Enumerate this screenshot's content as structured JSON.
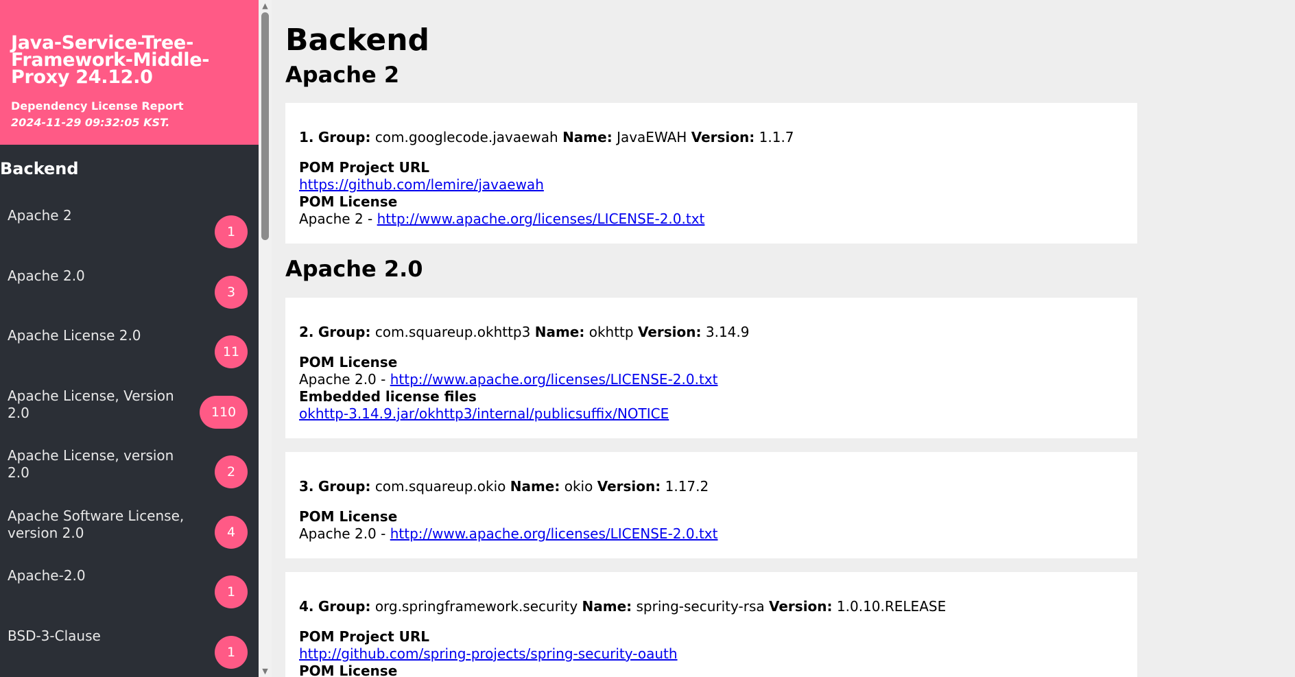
{
  "sidebar": {
    "project_title": "Java-Service-Tree-Framework-Middle-Proxy 24.12.0",
    "subtitle": "Dependency License Report",
    "timestamp": "2024-11-29 09:32:05 KST.",
    "section": "Backend",
    "items": [
      {
        "label": "Apache 2",
        "count": "1"
      },
      {
        "label": "Apache 2.0",
        "count": "3"
      },
      {
        "label": "Apache License 2.0",
        "count": "11"
      },
      {
        "label": "Apache License, Version 2.0",
        "count": "110"
      },
      {
        "label": "Apache License, version 2.0",
        "count": "2"
      },
      {
        "label": "Apache Software License, version 2.0",
        "count": "4"
      },
      {
        "label": "Apache-2.0",
        "count": "1"
      },
      {
        "label": "BSD-3-Clause",
        "count": "1"
      }
    ]
  },
  "scrollbar": {
    "up_icon": "▲",
    "down_icon": "▼"
  },
  "main": {
    "title": "Backend",
    "labels": {
      "group": "Group:",
      "name": "Name:",
      "version": "Version:",
      "pom_project_url": "POM Project URL",
      "pom_license": "POM License",
      "embedded_license_files": "Embedded license files"
    },
    "groups": [
      {
        "heading": "Apache 2",
        "deps": [
          {
            "num": "1.",
            "group": "com.googlecode.javaewah",
            "name": "JavaEWAH",
            "version": "1.1.7",
            "project_url": "https://github.com/lemire/javaewah",
            "license_name": "Apache 2 - ",
            "license_url": "http://www.apache.org/licenses/LICENSE-2.0.txt"
          }
        ]
      },
      {
        "heading": "Apache 2.0",
        "deps": [
          {
            "num": "2.",
            "group": "com.squareup.okhttp3",
            "name": "okhttp",
            "version": "3.14.9",
            "license_name": "Apache 2.0 - ",
            "license_url": "http://www.apache.org/licenses/LICENSE-2.0.txt",
            "embedded": "okhttp-3.14.9.jar/okhttp3/internal/publicsuffix/NOTICE"
          },
          {
            "num": "3.",
            "group": "com.squareup.okio",
            "name": "okio",
            "version": "1.17.2",
            "license_name": "Apache 2.0 - ",
            "license_url": "http://www.apache.org/licenses/LICENSE-2.0.txt"
          },
          {
            "num": "4.",
            "group": "org.springframework.security",
            "name": "spring-security-rsa",
            "version": "1.0.10.RELEASE",
            "project_url": "http://github.com/spring-projects/spring-security-oauth"
          }
        ]
      }
    ]
  }
}
